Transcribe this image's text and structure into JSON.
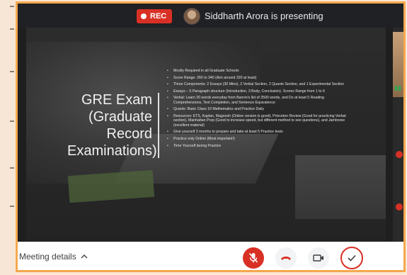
{
  "top_bar": {
    "rec_label": "REC",
    "presenter_text": "Siddharth Arora is presenting"
  },
  "slide": {
    "title": "GRE Exam (Graduate Record Examinations)",
    "bullets": [
      "Mostly Required in all Graduate Schools",
      "Score Range: 260 to 340 (Aim around 320 at least)",
      "Three Components: 2 Essays (30 Mins), 2 Verbal Section, 2 Quants Section, and 1 Experimental Section",
      "Essays – 5 Paragraph structure (Introduction, 3 Body, Conclusion). Scores Range from 1 to 6",
      "Verbal: Learn 20 words everyday from Barron's list of 3500 words, and Do at least 5 Reading Comprehensions, Text Completion, and Sentence Equivalence",
      "Quants: Basic Class 10 Mathematics and Practice Daily",
      "Resources: ETS, Kaplan, Magoosh (Online version is good), Princeton Review (Good for practicing Verbal section), Manhattan Prep (Good to increase speed, but different method to see questions), and Jamboree (excellent material)",
      "Give yourself 3 months to prepare and take at least 5 Practice tests",
      "Practice only Online (Most important!)",
      "Time Yourself during Practice"
    ]
  },
  "bottom_bar": {
    "meeting_details_label": "Meeting details"
  },
  "icons": {
    "rec": "record-dot-icon",
    "mic": "mic-off-icon",
    "hang_up": "hang-up-icon",
    "camera": "camera-icon",
    "check": "checkmark-icon"
  },
  "colors": {
    "accent_red": "#d93025",
    "frame_border": "#f5a84e",
    "top_bar_bg": "#202124"
  }
}
